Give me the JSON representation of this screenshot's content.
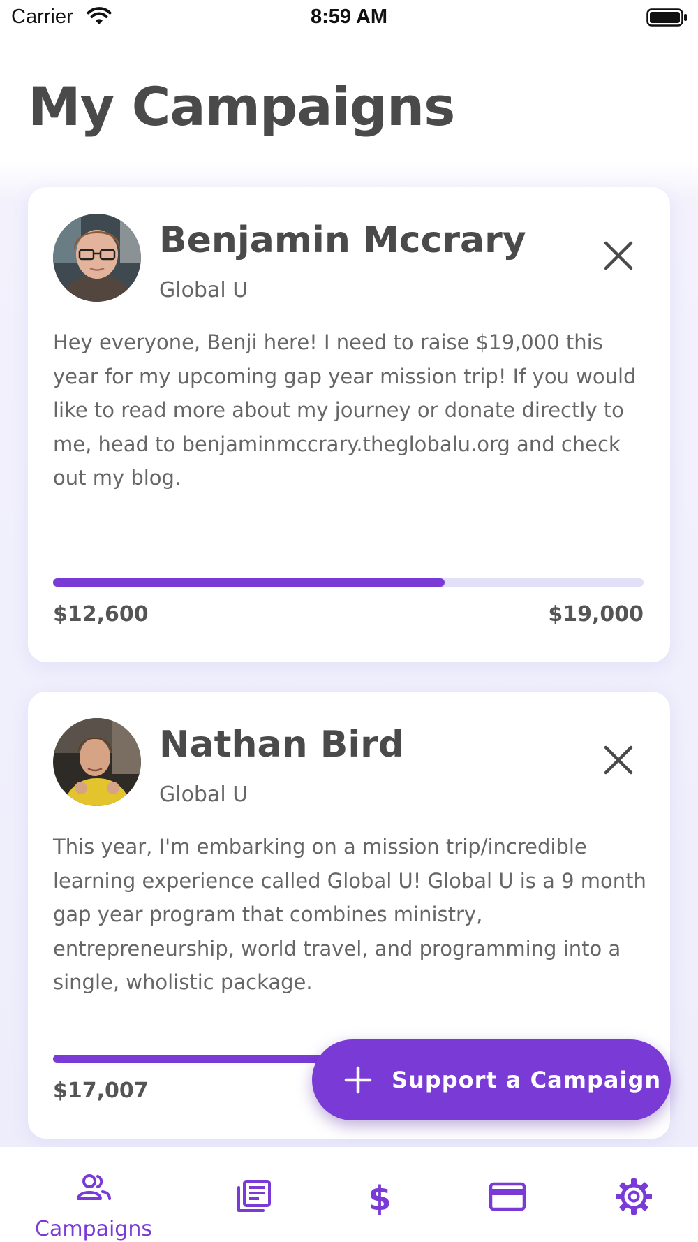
{
  "status_bar": {
    "carrier": "Carrier",
    "time": "8:59 AM"
  },
  "page": {
    "title": "My Campaigns"
  },
  "campaigns": [
    {
      "name": "Benjamin Mccrary",
      "org": "Global U",
      "description": "Hey everyone, Benji here! I need to raise $19,000 this year for my upcoming gap year mission trip! If you would like to read more about my journey or donate directly to me, head to benjaminmccrary.theglobalu.org and check out my blog.",
      "raised": "$12,600",
      "goal": "$19,000",
      "progress": 0.663
    },
    {
      "name": "Nathan Bird",
      "org": "Global U",
      "description": "This year, I'm embarking on a mission trip/incredible learning experience called Global U! Global U is a 9 month gap year program that combines ministry, entrepreneurship, world travel, and programming into a single, wholistic package.",
      "raised": "$17,007",
      "progress": 0.9
    }
  ],
  "fab": {
    "label": "Support a Campaign",
    "icon": "plus-icon"
  },
  "tabs": [
    {
      "label": "Campaigns",
      "icon": "people-icon",
      "active": true
    },
    {
      "icon": "newspaper-icon"
    },
    {
      "icon": "dollar-icon"
    },
    {
      "icon": "credit-card-icon"
    },
    {
      "icon": "gear-icon"
    }
  ],
  "colors": {
    "accent": "#7a3ad6",
    "track": "#e1e0f8",
    "text": "#4a4a4a",
    "background": "#eeedfb"
  }
}
